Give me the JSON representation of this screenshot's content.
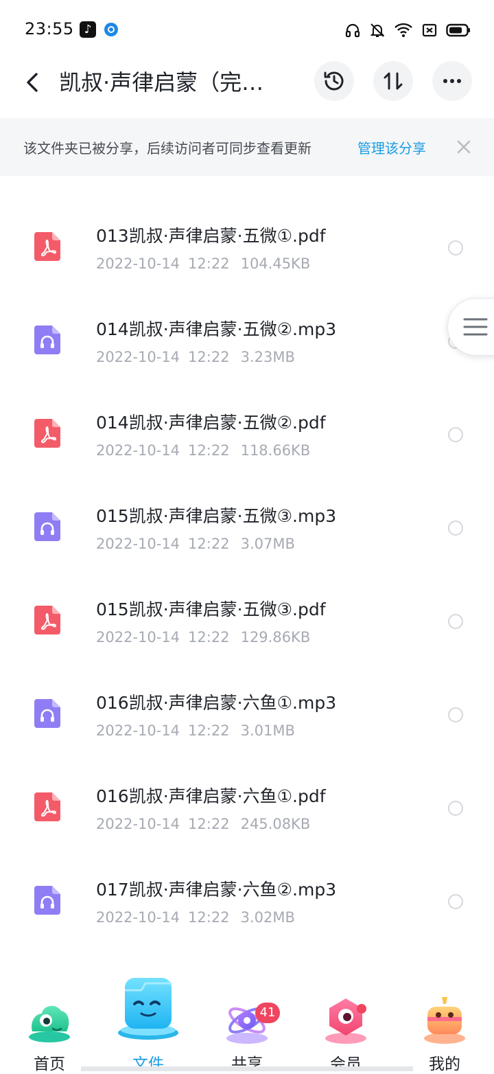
{
  "status_bar": {
    "time": "23:55"
  },
  "header": {
    "title": "凯叔·声律启蒙（完…"
  },
  "share_banner": {
    "text": "该文件夹已被分享，后续访问者可同步查看更新",
    "link": "管理该分享"
  },
  "files": [
    {
      "name": "",
      "date": "2022-10-14",
      "time": "12:22",
      "size": "3.02MB",
      "type": "audio"
    },
    {
      "name": "013凯叔·声律启蒙·五微①.pdf",
      "date": "2022-10-14",
      "time": "12:22",
      "size": "104.45KB",
      "type": "pdf"
    },
    {
      "name": "014凯叔·声律启蒙·五微②.mp3",
      "date": "2022-10-14",
      "time": "12:22",
      "size": "3.23MB",
      "type": "audio"
    },
    {
      "name": "014凯叔·声律启蒙·五微②.pdf",
      "date": "2022-10-14",
      "time": "12:22",
      "size": "118.66KB",
      "type": "pdf"
    },
    {
      "name": "015凯叔·声律启蒙·五微③.mp3",
      "date": "2022-10-14",
      "time": "12:22",
      "size": "3.07MB",
      "type": "audio"
    },
    {
      "name": "015凯叔·声律启蒙·五微③.pdf",
      "date": "2022-10-14",
      "time": "12:22",
      "size": "129.86KB",
      "type": "pdf"
    },
    {
      "name": "016凯叔·声律启蒙·六鱼①.mp3",
      "date": "2022-10-14",
      "time": "12:22",
      "size": "3.01MB",
      "type": "audio"
    },
    {
      "name": "016凯叔·声律启蒙·六鱼①.pdf",
      "date": "2022-10-14",
      "time": "12:22",
      "size": "245.08KB",
      "type": "pdf"
    },
    {
      "name": "017凯叔·声律启蒙·六鱼②.mp3",
      "date": "2022-10-14",
      "time": "12:22",
      "size": "3.02MB",
      "type": "audio"
    }
  ],
  "bottom_nav": {
    "items": [
      {
        "label": "首页",
        "active": false
      },
      {
        "label": "文件",
        "active": true
      },
      {
        "label": "共享",
        "active": false,
        "badge": "41"
      },
      {
        "label": "会员",
        "active": false,
        "dot": true
      },
      {
        "label": "我的",
        "active": false
      }
    ]
  },
  "colors": {
    "accent": "#1a9de6",
    "pdf_icon": "#f45b69",
    "audio_icon": "#8f7df5",
    "badge": "#f0455e"
  }
}
